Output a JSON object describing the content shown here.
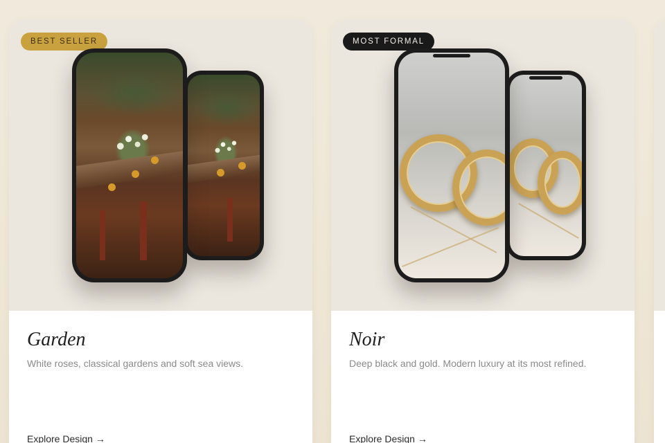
{
  "cards": [
    {
      "badge": "BEST SELLER",
      "title": "Garden",
      "description": "White roses, classical gardens and soft sea views.",
      "link": "Explore Design →",
      "badge_color": "#c9a23f"
    },
    {
      "badge": "MOST FORMAL",
      "title": "Noir",
      "description": "Deep black and gold. Modern luxury at its most refined.",
      "link": "Explore Design →",
      "badge_color": "#1a1a1a"
    }
  ],
  "colors": {
    "page_background": "#efe6d6",
    "preview_background": "#ebe7df",
    "gold_accent": "#c9a23f",
    "text_dark": "#1e1e1e",
    "text_muted": "#8a8a8a"
  }
}
